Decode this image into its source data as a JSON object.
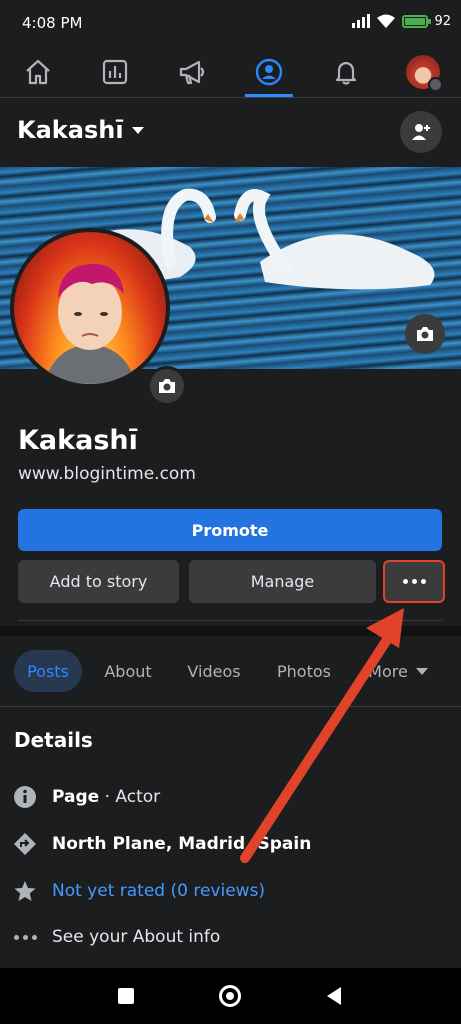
{
  "status_bar": {
    "time": "4:08 PM",
    "battery": "92"
  },
  "nav": {
    "items": [
      "home-icon",
      "insights-icon",
      "megaphone-icon",
      "profile-icon",
      "bell-icon",
      "avatar-menu"
    ],
    "active": "profile-icon"
  },
  "page_switcher": {
    "name": "Kakashī"
  },
  "profile": {
    "name": "Kakashī",
    "website": "www.blogintime.com"
  },
  "buttons": {
    "promote": "Promote",
    "add_story": "Add to story",
    "manage": "Manage",
    "more": "more-dots-icon"
  },
  "tabs": [
    {
      "label": "Posts",
      "active": true
    },
    {
      "label": "About"
    },
    {
      "label": "Videos"
    },
    {
      "label": "Photos"
    },
    {
      "label": "More"
    }
  ],
  "details": {
    "heading": "Details",
    "page_type_label": "Page",
    "page_type_value": " · Actor",
    "location": "North Plane, Madrid, Spain",
    "rating": "Not yet rated (0 reviews)",
    "about_link": "See your About info"
  },
  "colors": {
    "accent": "#2374e1",
    "link": "#4599ff",
    "annotation": "#e0432a",
    "background": "#1c1d1f"
  }
}
